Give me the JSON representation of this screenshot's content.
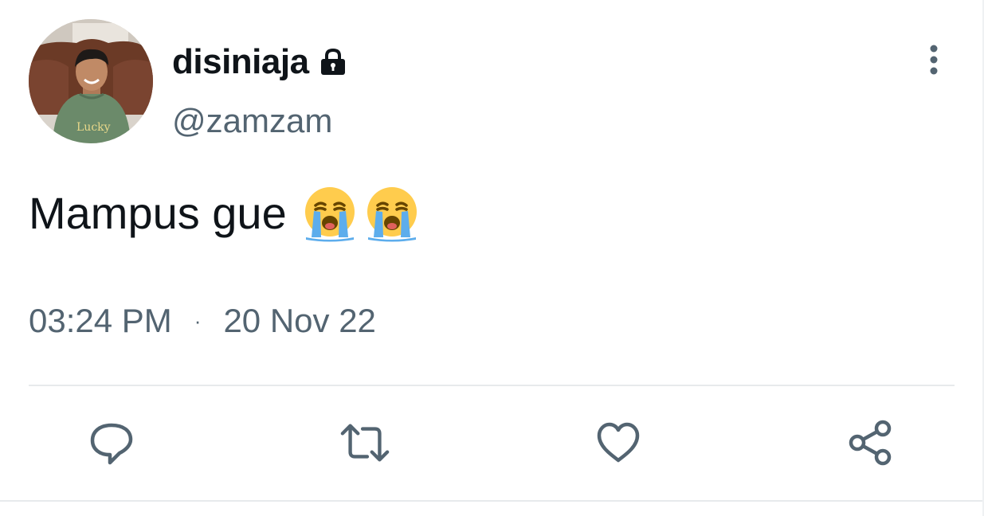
{
  "user": {
    "display_name": "disiniaja",
    "handle": "@zamzam",
    "avatar_icon": "profile-photo",
    "protected_icon": "lock-icon"
  },
  "tweet": {
    "text": "Mampus gue",
    "emojis": [
      "loudly-crying-face",
      "loudly-crying-face"
    ]
  },
  "meta": {
    "time": "03:24 PM",
    "separator": "·",
    "date": "20 Nov 22"
  },
  "actions": [
    {
      "name": "reply",
      "icon": "comment-icon"
    },
    {
      "name": "retweet",
      "icon": "retweet-icon"
    },
    {
      "name": "like",
      "icon": "heart-icon"
    },
    {
      "name": "share",
      "icon": "share-icon"
    }
  ],
  "colors": {
    "text_primary": "#0f1419",
    "text_secondary": "#536471",
    "divider": "#e7eaec"
  }
}
